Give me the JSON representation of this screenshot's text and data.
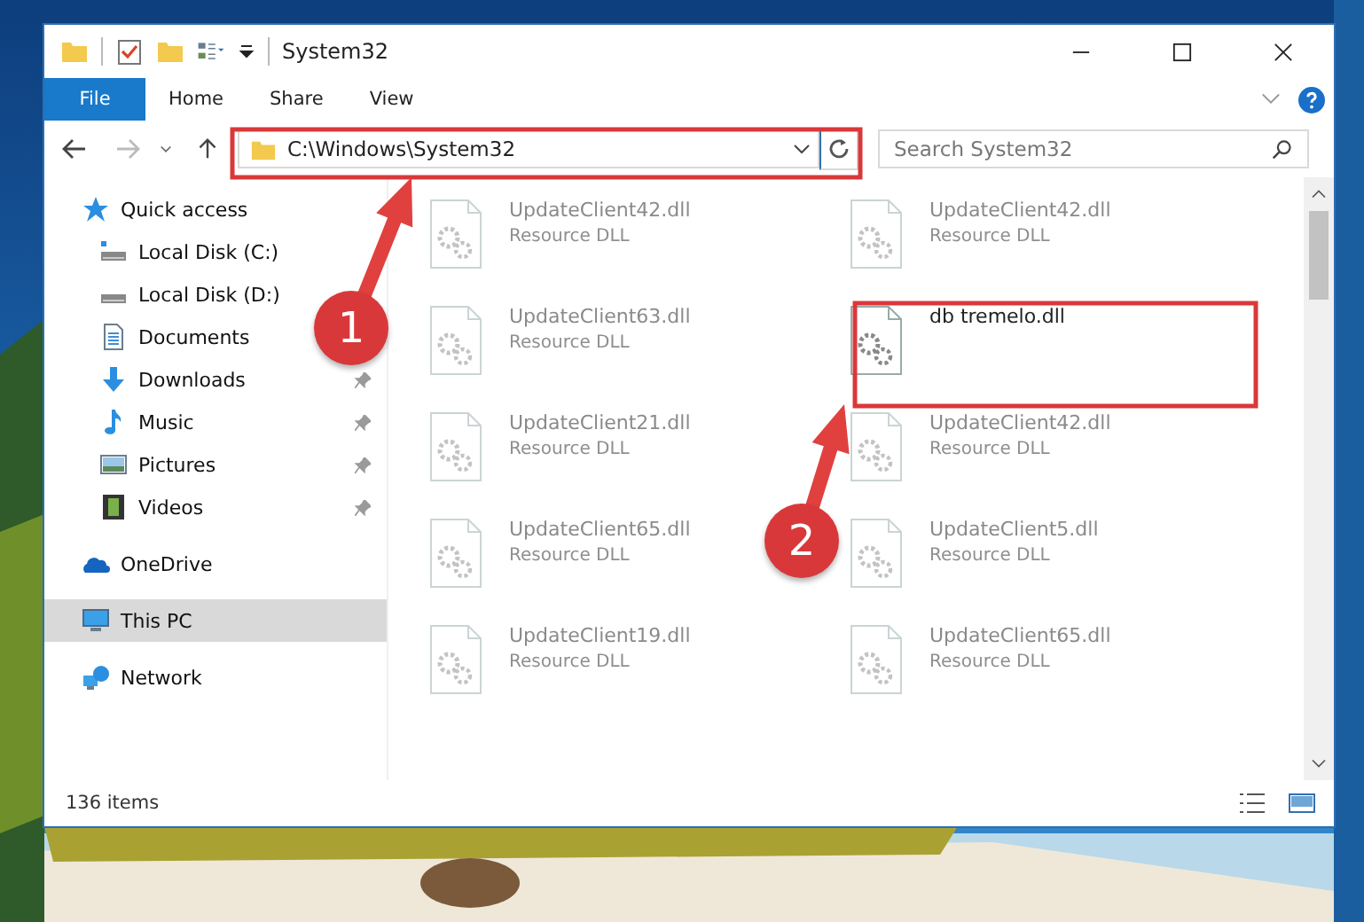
{
  "window": {
    "title": "System32"
  },
  "ribbon_tabs": [
    {
      "label": "File",
      "kind": "file"
    },
    {
      "label": "Home",
      "kind": "tab"
    },
    {
      "label": "Share",
      "kind": "tab"
    },
    {
      "label": "View",
      "kind": "tab"
    }
  ],
  "address_bar": {
    "path": "C:\\Windows\\System32"
  },
  "search": {
    "placeholder": "Search System32"
  },
  "sidebar": {
    "items": [
      {
        "label": "Quick access",
        "kind": "star",
        "pinned": false,
        "selected": false,
        "children": [
          {
            "label": "Local Disk (C:)",
            "kind": "drive-c",
            "pinned": false,
            "selected": false
          },
          {
            "label": "Local Disk (D:)",
            "kind": "drive",
            "pinned": false,
            "selected": false
          },
          {
            "label": "Documents",
            "kind": "document",
            "pinned": false,
            "selected": false
          },
          {
            "label": "Downloads",
            "kind": "download",
            "pinned": true,
            "selected": false
          },
          {
            "label": "Music",
            "kind": "music",
            "pinned": true,
            "selected": false
          },
          {
            "label": "Pictures",
            "kind": "pictures",
            "pinned": true,
            "selected": false
          },
          {
            "label": "Videos",
            "kind": "video",
            "pinned": true,
            "selected": false
          }
        ]
      },
      {
        "label": "OneDrive",
        "kind": "cloud",
        "pinned": false,
        "selected": false
      },
      {
        "label": "This PC",
        "kind": "pc",
        "pinned": false,
        "selected": true
      },
      {
        "label": "Network",
        "kind": "network",
        "pinned": false,
        "selected": false
      }
    ]
  },
  "files": [
    {
      "name": "UpdateClient42.dll",
      "type": "Resource DLL",
      "faded": true
    },
    {
      "name": "UpdateClient42.dll",
      "type": "Resource DLL",
      "faded": true
    },
    {
      "name": "UpdateClient63.dll",
      "type": "Resource DLL",
      "faded": true
    },
    {
      "name": "db tremelo.dll",
      "faded": false
    },
    {
      "name": "UpdateClient21.dll",
      "type": "Resource DLL",
      "faded": true
    },
    {
      "name": "UpdateClient42.dll",
      "type": "Resource DLL",
      "faded": true
    },
    {
      "name": "UpdateClient65.dll",
      "type": "Resource DLL",
      "faded": true
    },
    {
      "name": "UpdateClient5.dll",
      "type": "Resource DLL",
      "faded": true
    },
    {
      "name": "UpdateClient19.dll",
      "type": "Resource DLL",
      "faded": true
    },
    {
      "name": "UpdateClient65.dll",
      "type": "Resource DLL",
      "faded": true
    }
  ],
  "status_bar": {
    "item_count": "136 items"
  },
  "annotations": [
    {
      "number": "1"
    },
    {
      "number": "2"
    }
  ]
}
